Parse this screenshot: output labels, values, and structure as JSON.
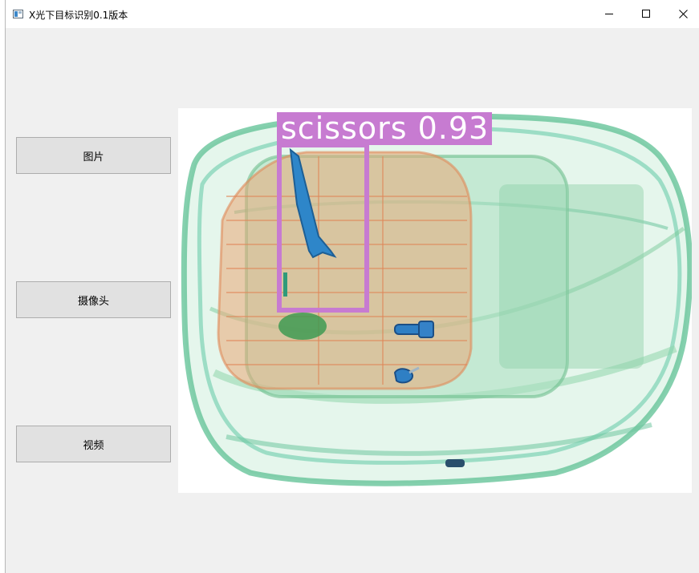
{
  "window": {
    "title": "X光下目标识别0.1版本",
    "icon": "app-window-icon",
    "controls": {
      "minimize": "minimize-icon",
      "maximize": "maximize-icon",
      "close": "close-icon"
    }
  },
  "sidebar": {
    "buttons": [
      {
        "label": "图片"
      },
      {
        "label": "摄像头"
      },
      {
        "label": "视频"
      }
    ]
  },
  "display": {
    "detections": [
      {
        "label": "scissors 0.93",
        "color": "#c77bd1"
      }
    ]
  }
}
